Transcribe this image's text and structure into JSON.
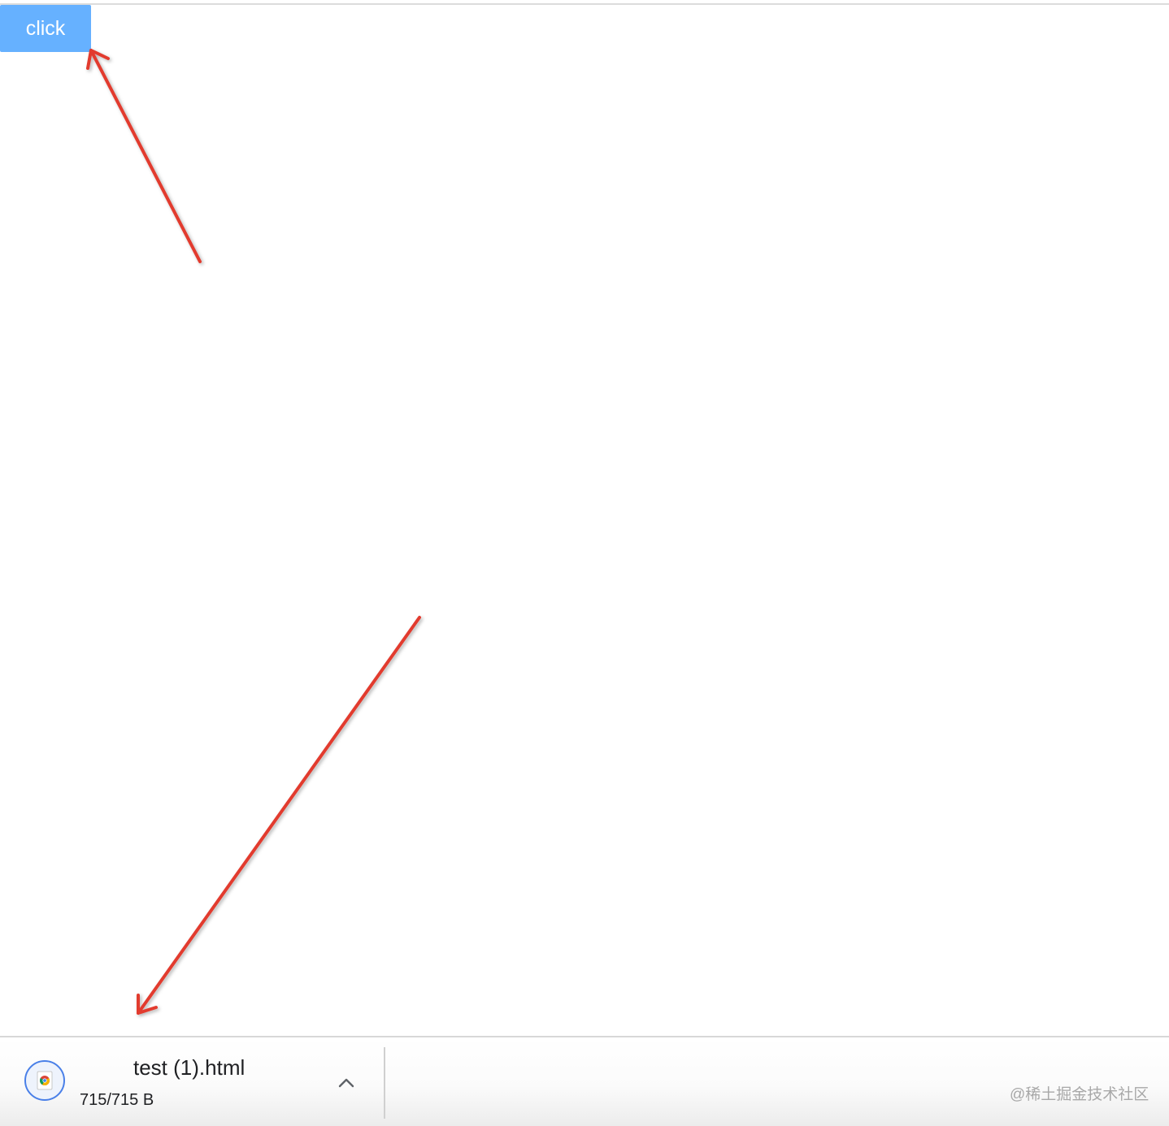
{
  "page": {
    "button_label": "click"
  },
  "download_shelf": {
    "item": {
      "icon": "chrome-html-file-icon",
      "file_name": "test (1).html",
      "status": "715/715 B",
      "menu_icon": "chevron-up-icon"
    },
    "watermark": "@稀土掘金技术社区"
  },
  "annotations": {
    "arrow_color": "#e23a2e",
    "arrows": [
      "arrow-to-click-button",
      "arrow-to-download-item"
    ]
  },
  "colors": {
    "button_bg": "#66b1ff",
    "icon_ring": "#4a80e8"
  }
}
